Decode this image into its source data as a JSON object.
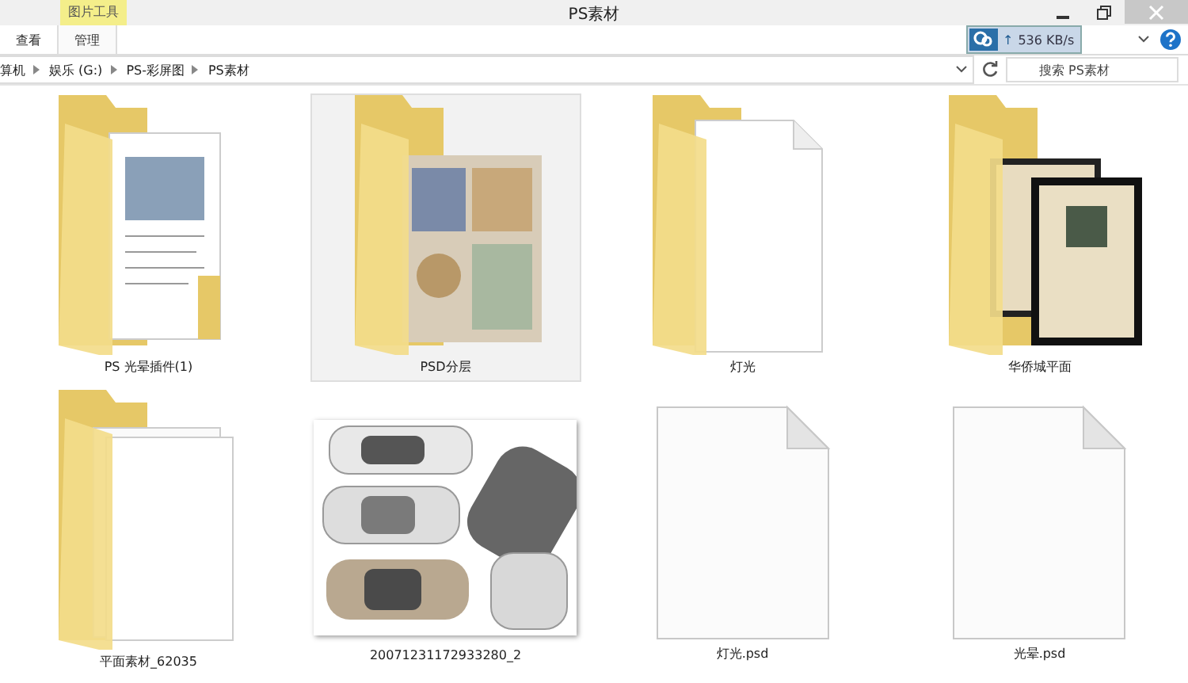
{
  "window": {
    "title": "PS素材"
  },
  "ribbon": {
    "context_header": "图片工具",
    "tabs": [
      {
        "label": "查看",
        "selected": false
      },
      {
        "label": "管理",
        "selected": false
      }
    ]
  },
  "speed_widget": {
    "arrow": "↑",
    "reading": "536 KB/s"
  },
  "address_bar": {
    "crumbs": [
      "算机",
      "娱乐 (G:)",
      "PS-彩屏图",
      "PS素材"
    ]
  },
  "search": {
    "placeholder": "搜索 PS素材"
  },
  "items": [
    {
      "name": "PS 光晕插件(1)",
      "kind": "docs",
      "selected": false
    },
    {
      "name": "PSD分层",
      "kind": "plan",
      "selected": true
    },
    {
      "name": "灯光",
      "kind": "blank",
      "selected": false
    },
    {
      "name": "华侨城平面",
      "kind": "frames",
      "selected": false
    },
    {
      "name": "平面素材_62035",
      "kind": "sheets",
      "selected": false
    },
    {
      "name": "20071231172933280_2",
      "selected": false
    },
    {
      "name": "灯光.psd",
      "kind": "file",
      "selected": false
    },
    {
      "name": "光晕.psd",
      "kind": "file",
      "selected": false
    }
  ]
}
